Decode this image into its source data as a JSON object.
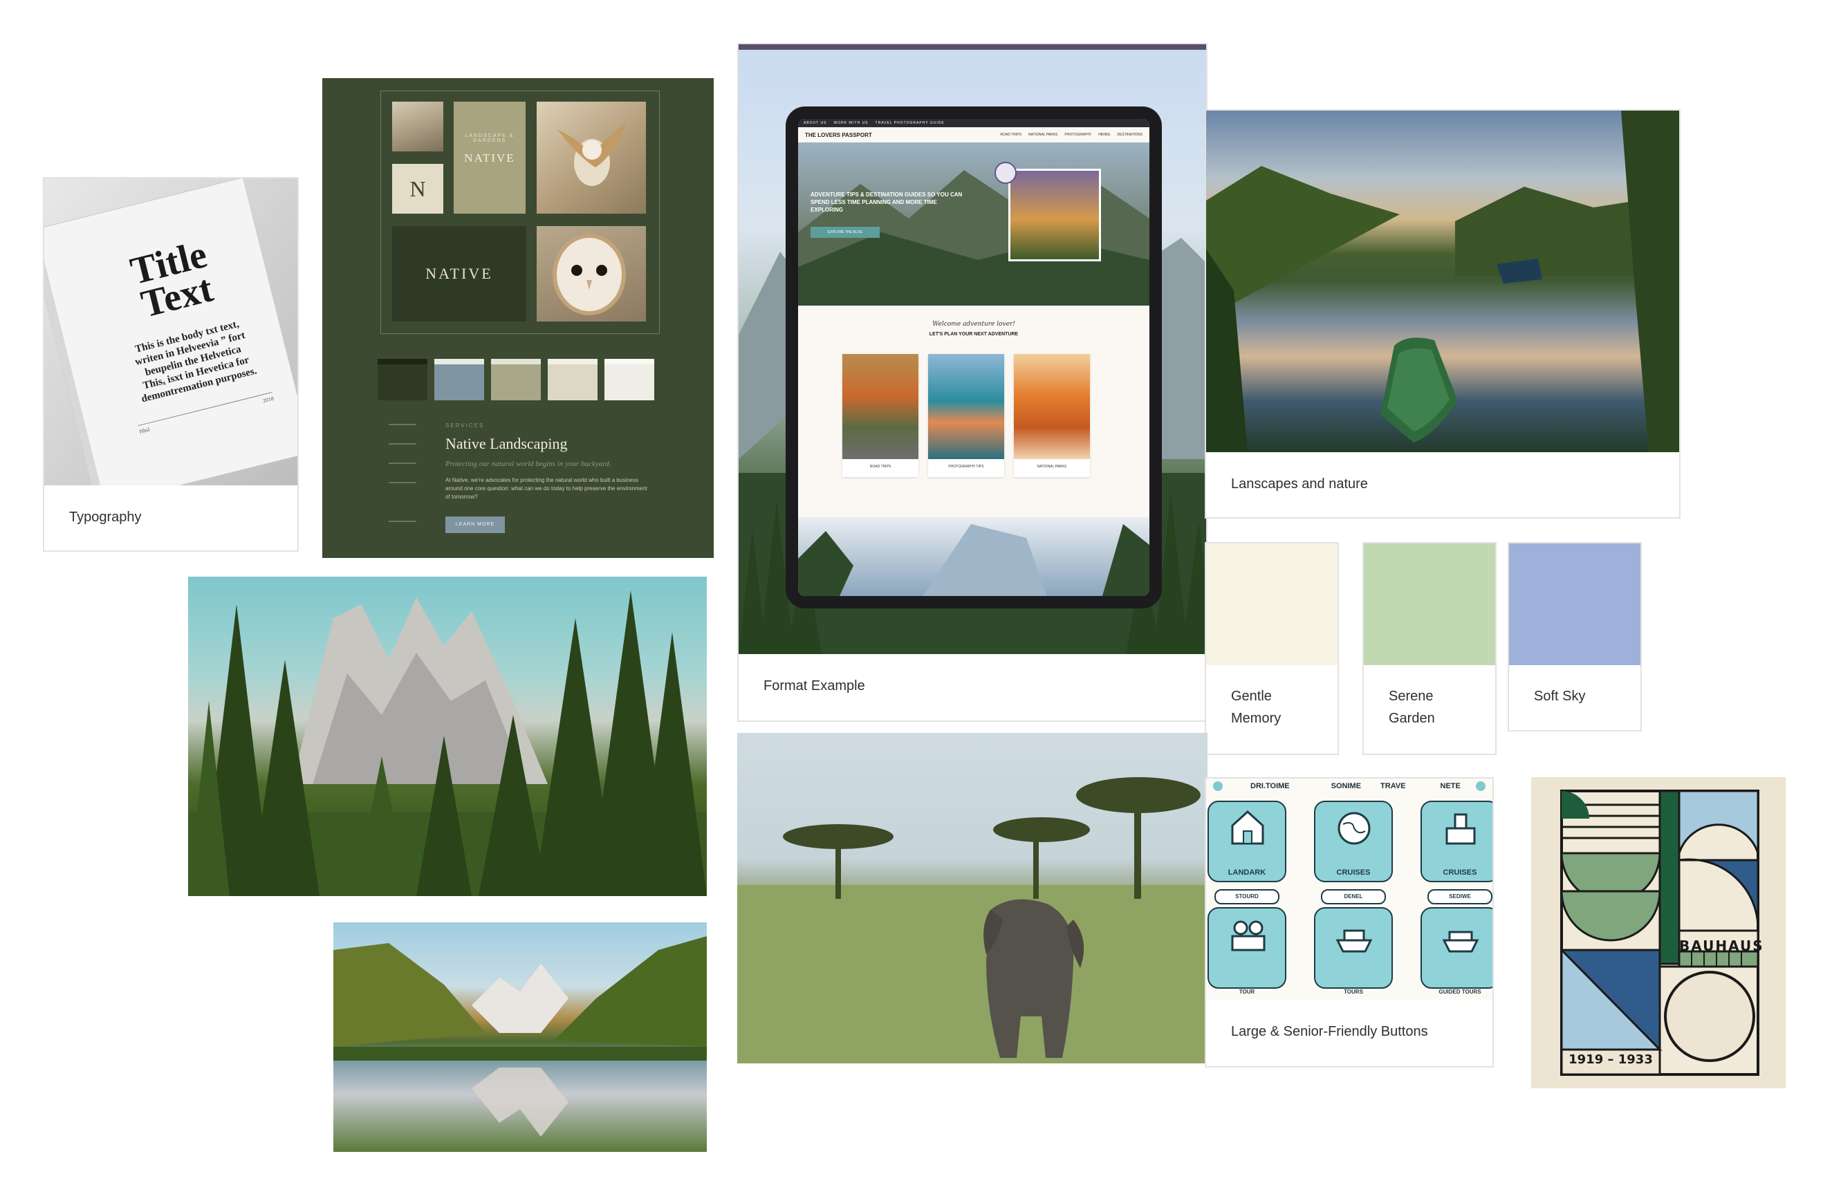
{
  "cards": {
    "typography": {
      "label": "Typography",
      "book": {
        "title_line1": "Title",
        "title_line2": "Text",
        "body_lines": [
          "This is the body txt text,",
          "writen in Helveevia ” fort",
          "beupelin the Helvetica",
          "Thisₓ isxt in Hevetica for",
          "demontremation purposes."
        ],
        "footer_left": "Hhsl",
        "footer_right": "2018"
      }
    },
    "native": {
      "badge_letter": "N",
      "badge_word": "NATIVE",
      "badge_arc": "LANDSCAPE & GARDENS",
      "dark_word": "NATIVE",
      "section_kicker": "SERVICES",
      "heading": "Native Landscaping",
      "subheading": "Protecting our natural world begins in your backyard.",
      "paragraph": "At Native, we're advocates for protecting the natural world who built a business around one core question: what can we do today to help preserve the environment of tomorrow?",
      "button": "LEARN MORE",
      "palette": [
        "#2e3a24",
        "#7f95a1",
        "#a8a78a",
        "#ddd8c4",
        "#eeede6"
      ]
    },
    "format": {
      "label": "Format Example",
      "site": {
        "brand": "THE LOVERS PASSPORT",
        "topbar": [
          "ABOUT US",
          "WORK WITH US",
          "TRAVEL PHOTOGRAPHY GUIDE"
        ],
        "nav": [
          "ROAD TRIPS",
          "NATIONAL PARKS",
          "PHOTOGRAPHY",
          "HIKING",
          "DESTINATIONS"
        ],
        "hero_text": "ADVENTURE TIPS & DESTINATION GUIDES SO YOU CAN SPEND LESS TIME PLANNING AND MORE TIME EXPLORING",
        "hero_button": "EXPLORE THE BLOG",
        "script_line": "Welcome adventure lover!",
        "section_title": "LET'S PLAN YOUR NEXT ADVENTURE",
        "tiles": [
          "ROAD TRIPS",
          "PHOTOGRAPHY TIPS",
          "NATIONAL PARKS"
        ]
      }
    },
    "landscapes": {
      "label": "Lanscapes and nature"
    },
    "buttons": {
      "label": "Large & Senior-Friendly Buttons",
      "topbar": [
        "DRI.TOIME",
        "SONIME",
        "TRAVE",
        "NETE"
      ],
      "tiles": [
        {
          "title": "LANDARK",
          "pill": "STOURD"
        },
        {
          "title": "CRUISES",
          "pill": "DENEL"
        },
        {
          "title": "CRUISES",
          "pill": "SEDIWE"
        },
        {
          "title": "",
          "pill": "TOUR"
        },
        {
          "title": "",
          "pill": "TOURS"
        },
        {
          "title": "",
          "pill": "GUIDED TOURS"
        }
      ]
    }
  },
  "swatches": [
    {
      "name_line1": "Gentle",
      "name_line2": "Memory",
      "color": "#f8f4e4"
    },
    {
      "name_line1": "Serene",
      "name_line2": "Garden",
      "color": "#c2d8b3"
    },
    {
      "name_line1": "Soft Sky",
      "name_line2": "",
      "color": "#9db1da"
    }
  ],
  "poster": {
    "word": "BAUHAUS",
    "years": "1919 – 1933"
  }
}
